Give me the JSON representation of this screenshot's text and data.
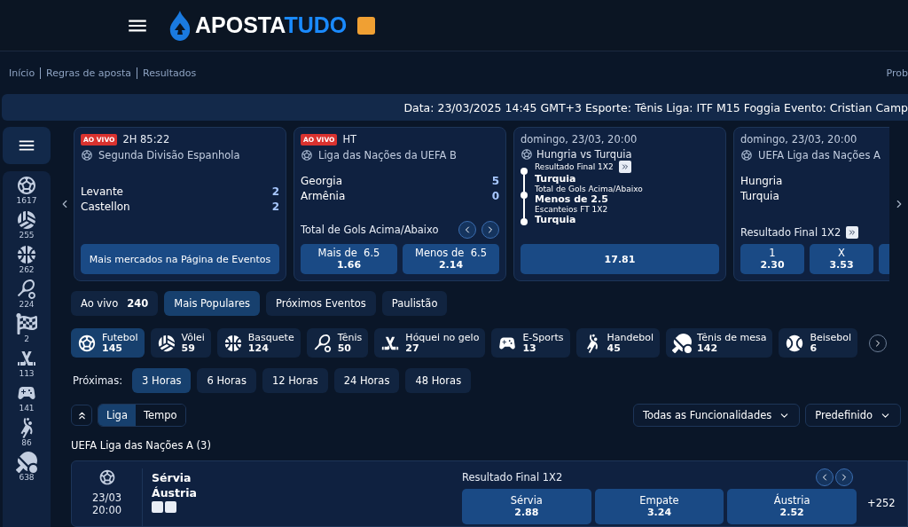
{
  "header": {
    "logo_primary": "APOSTA",
    "logo_secondary": "TUDO"
  },
  "breadcrumbs": [
    "Início",
    "Regras de aposta",
    "Resultados"
  ],
  "breadcrumb_right": "Prob",
  "ticker": "Data: 23/03/2025 14:45 GMT+3 Esporte: Tênis Liga: ITF M15 Foggia Evento: Cristian Camp",
  "sidebar_sports": [
    {
      "kind": "soccer",
      "count": "1617"
    },
    {
      "kind": "volleyball",
      "count": "255"
    },
    {
      "kind": "basketball",
      "count": "262"
    },
    {
      "kind": "tennis",
      "count": "224"
    },
    {
      "kind": "flag",
      "count": "2"
    },
    {
      "kind": "hockey",
      "count": "113"
    },
    {
      "kind": "esports",
      "count": "141"
    },
    {
      "kind": "handball",
      "count": "86"
    },
    {
      "kind": "tabletennis",
      "count": "638"
    }
  ],
  "featured_cards": [
    {
      "kind": "live",
      "badge": "AO VIVO",
      "time": "2H 85:22",
      "league": "Segunda Divisão Espanhola",
      "teams": [
        {
          "name": "Levante",
          "score": "2"
        },
        {
          "name": "Castellon",
          "score": "2"
        }
      ],
      "button": "Mais mercados na Página de Eventos"
    },
    {
      "kind": "live_market",
      "badge": "AO VIVO",
      "time": "HT",
      "league": "Liga das Nações da UEFA B",
      "teams": [
        {
          "name": "Georgia",
          "score": "5"
        },
        {
          "name": "Armênia",
          "score": "0"
        }
      ],
      "market": "Total de Gols Acima/Abaixo",
      "odds": [
        {
          "label": "Mais de  6.5",
          "value": "1.66"
        },
        {
          "label": "Menos de  6.5",
          "value": "2.14"
        }
      ]
    },
    {
      "kind": "combo",
      "date": "domingo, 23/03, 20:00",
      "title": "Hungria vs Turquia",
      "selections": [
        {
          "market": "Resultado Final 1X2",
          "pick": "Turquia"
        },
        {
          "market": "Total de Gols Acima/Abaixo",
          "pick": "Menos de 2.5"
        },
        {
          "market": "Escanteios FT 1X2",
          "pick": "Turquia"
        }
      ],
      "odds": "17.81"
    },
    {
      "kind": "prematch",
      "date": "domingo, 23/03, 20:00",
      "league": "UEFA Liga das Nações A",
      "teams": [
        "Hungria",
        "Turquia"
      ],
      "market": "Resultado Final 1X2",
      "odds": [
        {
          "label": "1",
          "value": "2.30"
        },
        {
          "label": "X",
          "value": "3.53"
        }
      ]
    }
  ],
  "tabs": [
    {
      "label": "Ao vivo",
      "count": "240",
      "selected": false
    },
    {
      "label": "Mais Populares",
      "selected": true
    },
    {
      "label": "Próximos Eventos",
      "selected": false
    },
    {
      "label": "Paulistão",
      "selected": false
    }
  ],
  "sports_filter": [
    {
      "kind": "soccer",
      "label": "Futebol",
      "count": "145",
      "selected": true
    },
    {
      "kind": "volleyball",
      "label": "Vôlei",
      "count": "59",
      "selected": false
    },
    {
      "kind": "basketball",
      "label": "Basquete",
      "count": "124",
      "selected": false
    },
    {
      "kind": "tennis",
      "label": "Tênis",
      "count": "50",
      "selected": false
    },
    {
      "kind": "hockey",
      "label": "Hóquei no gelo",
      "count": "27",
      "selected": false
    },
    {
      "kind": "esports",
      "label": "E-Sports",
      "count": "13",
      "selected": false
    },
    {
      "kind": "handball",
      "label": "Handebol",
      "count": "45",
      "selected": false
    },
    {
      "kind": "tabletennis",
      "label": "Tênis de mesa",
      "count": "142",
      "selected": false
    },
    {
      "kind": "baseball",
      "label": "Beisebol",
      "count": "6",
      "selected": false
    }
  ],
  "time_filter": {
    "label": "Próximas:",
    "options": [
      {
        "label": "3 Horas",
        "selected": true
      },
      {
        "label": "6 Horas",
        "selected": false
      },
      {
        "label": "12 Horas",
        "selected": false
      },
      {
        "label": "24 Horas",
        "selected": false
      },
      {
        "label": "48 Horas",
        "selected": false
      }
    ]
  },
  "view_toggle": [
    {
      "label": "Liga",
      "selected": true
    },
    {
      "label": "Tempo",
      "selected": false
    }
  ],
  "dropdowns": [
    "Todas as Funcionalidades",
    "Predefinido"
  ],
  "league": {
    "title": "UEFA Liga das Nações A (3)",
    "events": [
      {
        "date": "23/03",
        "time": "20:00",
        "teams": [
          "Sérvia",
          "Áustria"
        ],
        "market": "Resultado Final 1X2",
        "odds": [
          {
            "label": "Sérvia",
            "value": "2.88"
          },
          {
            "label": "Empate",
            "value": "3.24"
          },
          {
            "label": "Áustria",
            "value": "2.52"
          }
        ],
        "more": "+252"
      }
    ]
  }
}
